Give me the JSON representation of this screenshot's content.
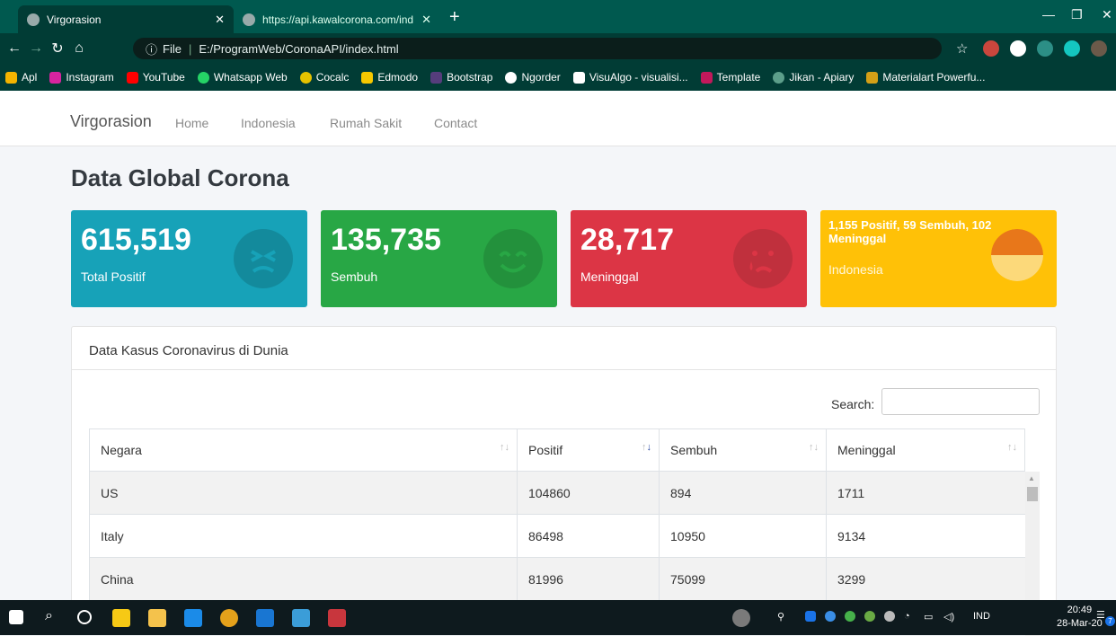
{
  "browser": {
    "tabs": [
      {
        "label": "Virgorasion",
        "active": true
      },
      {
        "label": "https://api.kawalcorona.com/ind"
      }
    ],
    "new_tab": "+",
    "address": {
      "scheme": "File",
      "path": "E:/ProgramWeb/CoronaAPI/index.html"
    },
    "bookmarks": [
      {
        "label": "Apl",
        "color": "#f4b400"
      },
      {
        "label": "Instagram",
        "color": "#d6249f"
      },
      {
        "label": "YouTube",
        "color": "#ff0000"
      },
      {
        "label": "Whatsapp Web",
        "color": "#25d366"
      },
      {
        "label": "Cocalc",
        "color": "#e6c200"
      },
      {
        "label": "Edmodo",
        "color": "#f7c800"
      },
      {
        "label": "Bootstrap",
        "color": "#563d7c"
      },
      {
        "label": "Ngorder",
        "color": "#ffffff"
      },
      {
        "label": "VisuAlgo - visualisi...",
        "color": "#222222"
      },
      {
        "label": "Template",
        "color": "#c2185b"
      },
      {
        "label": "Jikan - Apiary",
        "color": "#5c9e8a"
      },
      {
        "label": "Materialart Powerfu...",
        "color": "#333333"
      }
    ]
  },
  "site": {
    "brand": "Virgorasion",
    "nav": [
      "Home",
      "Indonesia",
      "Rumah Sakit",
      "Contact"
    ],
    "title": "Data Global Corona",
    "cards": [
      {
        "value": "615,519",
        "label": "Total Positif",
        "color": "#17a2b8",
        "icon": "sad-face-icon"
      },
      {
        "value": "135,735",
        "label": "Sembuh",
        "color": "#28a745",
        "icon": "happy-face-icon"
      },
      {
        "value": "28,717",
        "label": "Meninggal",
        "color": "#dc3545",
        "icon": "crying-face-icon"
      },
      {
        "value": "1,155 Positif, 59 Sembuh, 102 Meninggal",
        "label": "Indonesia",
        "color": "#ffc107",
        "icon": "flag-circle-icon"
      }
    ],
    "panel": {
      "title": "Data Kasus Coronavirus di Dunia",
      "search_label": "Search:",
      "columns": [
        "Negara",
        "Positif",
        "Sembuh",
        "Meninggal"
      ],
      "rows": [
        [
          "US",
          "104860",
          "894",
          "1711"
        ],
        [
          "Italy",
          "86498",
          "10950",
          "9134"
        ],
        [
          "China",
          "81996",
          "75099",
          "3299"
        ]
      ]
    }
  },
  "taskbar": {
    "lang": "IND",
    "time": "20:49",
    "date": "28-Mar-20",
    "notif_count": "7"
  }
}
